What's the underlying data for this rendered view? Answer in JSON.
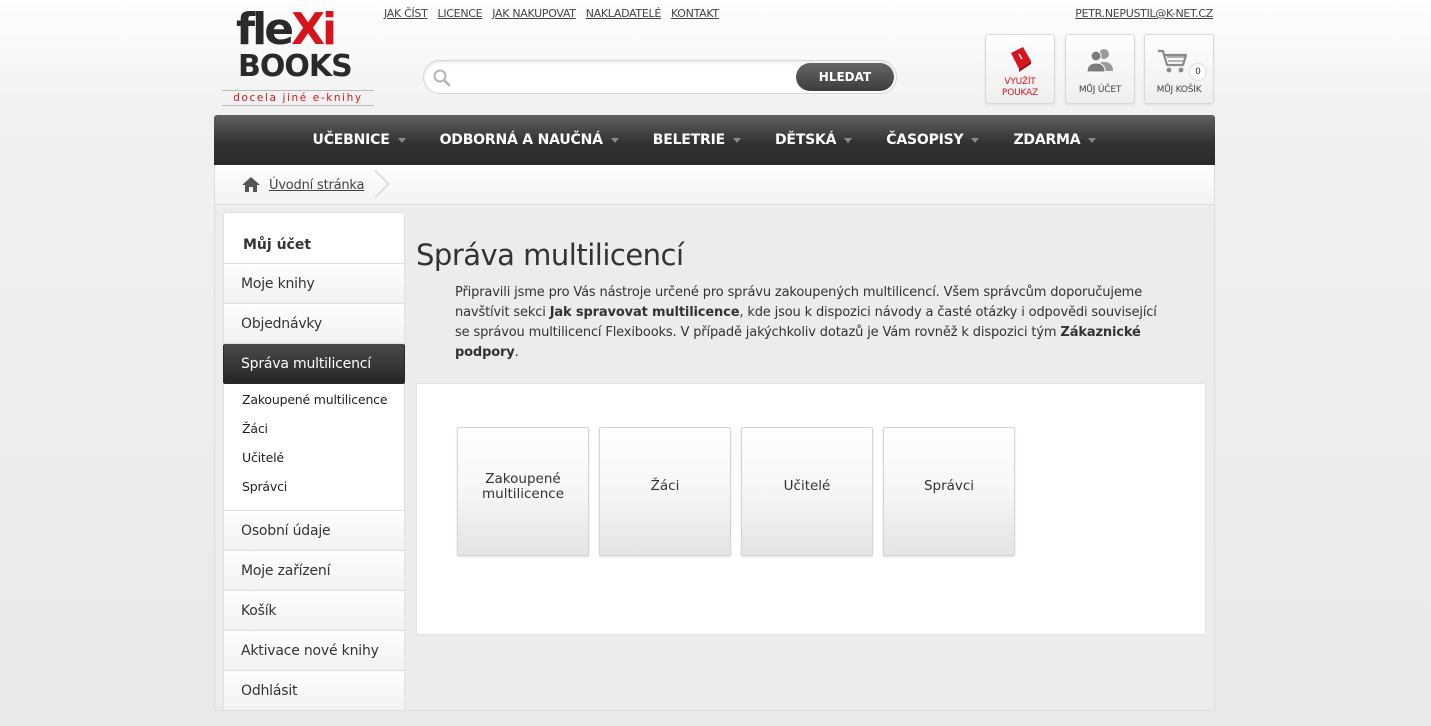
{
  "logo": {
    "line1_dark": "fle",
    "line1_red": "Xi",
    "line2": "BOOKS",
    "tagline": "docela jiné e-knihy"
  },
  "top_links": [
    "JAK ČÍST",
    "LICENCE",
    "JAK NAKUPOVAT",
    "NAKLADATELÉ",
    "KONTAKT"
  ],
  "user_email": "PETR.NEPUSTIL@K-NET.CZ",
  "search": {
    "value": "",
    "button_label": "HLEDAT"
  },
  "header_buttons": {
    "voucher_line1": "VYUŽÍT",
    "voucher_line2": "POUKAZ",
    "account_label": "MŮJ ÚČET",
    "cart_label": "MŮJ KOŠÍK",
    "cart_count": "0"
  },
  "main_nav": [
    "UČEBNICE",
    "ODBORNÁ A NAUČNÁ",
    "BELETRIE",
    "DĚTSKÁ",
    "ČASOPISY",
    "ZDARMA"
  ],
  "breadcrumb": {
    "home_label": "Úvodní stránka"
  },
  "sidebar": {
    "heading": "Můj účet",
    "items_top": [
      "Moje knihy",
      "Objednávky"
    ],
    "active": "Správa multilicencí",
    "subitems": [
      "Zakoupené multilicence",
      "Žáci",
      "Učitelé",
      "Správci"
    ],
    "items_bottom": [
      "Osobní údaje",
      "Moje zařízení",
      "Košík",
      "Aktivace nové knihy",
      "Odhlásit"
    ]
  },
  "page": {
    "title": "Správa multilicencí",
    "intro_1": "Připravili jsme pro Vás nástroje určené pro správu zakoupených multilicencí. Všem správcům doporučujeme navštívit sekci ",
    "intro_link_1": "Jak spravovat multilicence",
    "intro_2": ", kde jsou k dispozici návody a časté otázky i odpovědi související se správou multilicencí Flexibooks. V případě jakýchkoliv dotazů je Vám rovněž k dispozici tým ",
    "intro_link_2": "Zákaznické podpory",
    "intro_3": "."
  },
  "tiles": [
    "Zakoupené multilicence",
    "Žáci",
    "Učitelé",
    "Správci"
  ],
  "colors": {
    "brand_red": "#d6141d",
    "nav_dark": "#333333"
  },
  "icons": {
    "search": "magnifier-icon",
    "voucher": "voucher-book-icon",
    "account": "users-icon",
    "cart": "cart-icon",
    "home": "home-icon",
    "nav_caret": "chevron-down-icon"
  }
}
